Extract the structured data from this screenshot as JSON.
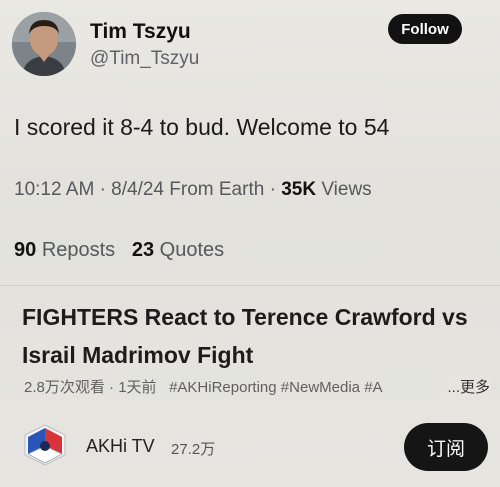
{
  "profile": {
    "name": "Tim Tszyu",
    "handle": "@Tim_Tszyu",
    "follow_label": "Follow"
  },
  "tweet": {
    "text": "I scored it 8-4 to bud. Welcome to 54",
    "time": "10:12 AM",
    "date": "8/4/24",
    "source": "From Earth",
    "views_count": "35K",
    "views_label": "Views",
    "reposts_count": "90",
    "reposts_label": "Reposts",
    "quotes_count": "23",
    "quotes_label": "Quotes"
  },
  "video": {
    "title": "FIGHTERS React to Terence Crawford vs Israil Madrimov Fight",
    "views": "2.8万次观看",
    "age": "1天前",
    "tags": [
      "#AKHiReporting",
      "#NewMedia",
      "#A"
    ],
    "more_label": "...更多",
    "channel_name": "AKHi TV",
    "subscriber_count": "27.2万",
    "subscribe_label": "订阅"
  }
}
